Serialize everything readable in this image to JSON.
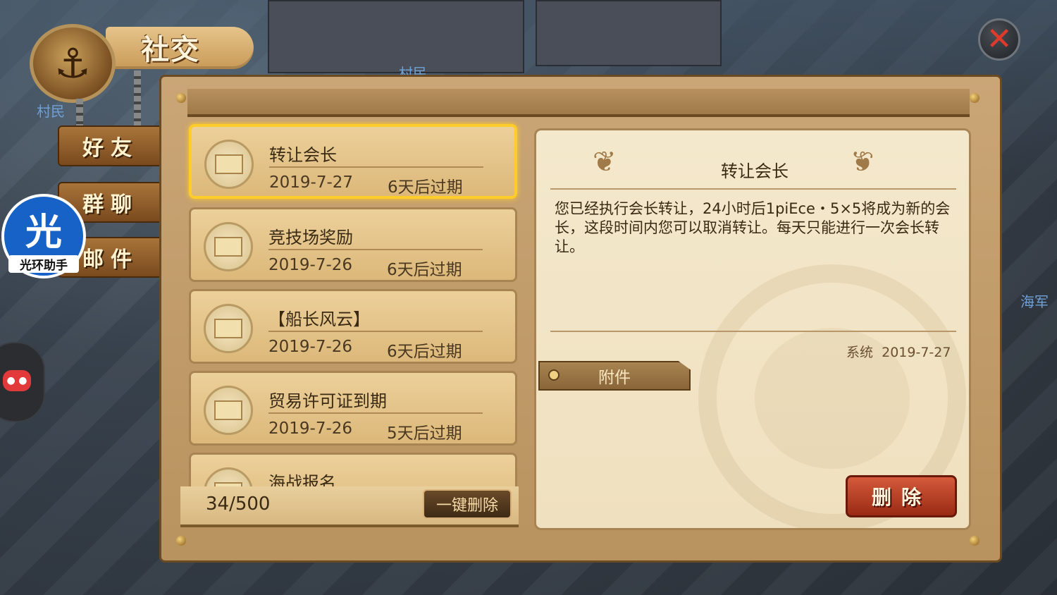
{
  "window": {
    "title": "社交"
  },
  "tabs": [
    {
      "label": "好友"
    },
    {
      "label": "群聊"
    },
    {
      "label": "邮件"
    }
  ],
  "assistant": {
    "glyph": "光",
    "label": "光环助手"
  },
  "background_labels": [
    "村民",
    "村民",
    "海军"
  ],
  "mails": [
    {
      "title": "转让会长",
      "date": "2019-7-27",
      "expire": "6天后过期",
      "selected": true
    },
    {
      "title": "竞技场奖励",
      "date": "2019-7-26",
      "expire": "6天后过期",
      "selected": false
    },
    {
      "title": "【船长风云】",
      "date": "2019-7-26",
      "expire": "6天后过期",
      "selected": false
    },
    {
      "title": "贸易许可证到期",
      "date": "2019-7-26",
      "expire": "5天后过期",
      "selected": false
    },
    {
      "title": "海战报名",
      "date": "",
      "expire": "",
      "selected": false
    }
  ],
  "mail_count": "34/500",
  "delete_all_label": "一键删除",
  "detail": {
    "title": "转让会长",
    "body": "您已经执行会长转让，24小时后1piEce・5×5将成为新的会长，这段时间内您可以取消转让。每天只能进行一次会长转让。",
    "sender": "系统",
    "date": "2019-7-27",
    "attachment_label": "附件",
    "delete_label": "删除"
  },
  "icons": {
    "close": "close-icon",
    "emblem": "anchor-icon",
    "mail": "envelope-icon",
    "gamepad": "gamepad-icon"
  },
  "colors": {
    "accent_selected": "#ffcc2a",
    "close_x": "#e23a2a",
    "delete_button": "#b8401e",
    "parchment": "#efe0bf"
  }
}
